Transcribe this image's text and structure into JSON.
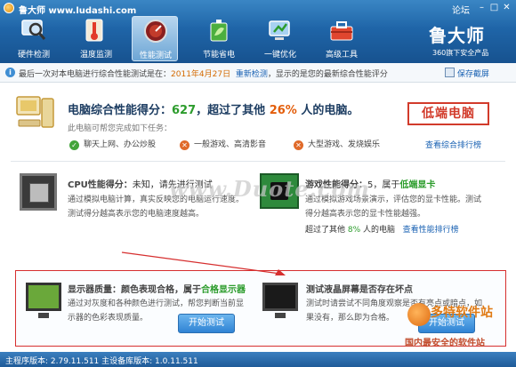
{
  "window": {
    "title": "鲁大师 www.ludashi.com",
    "forum_link": "论坛",
    "min": "–",
    "max": "□",
    "close": "✕"
  },
  "nav": {
    "tabs": [
      {
        "label": "硬件检测",
        "icon": "magnifier-monitor-icon"
      },
      {
        "label": "温度监测",
        "icon": "thermometer-icon"
      },
      {
        "label": "性能测试",
        "icon": "gauge-icon",
        "active": true
      },
      {
        "label": "节能省电",
        "icon": "battery-leaf-icon"
      },
      {
        "label": "一键优化",
        "icon": "optimize-icon"
      },
      {
        "label": "高级工具",
        "icon": "toolbox-icon"
      }
    ]
  },
  "brand": {
    "name": "鲁大师",
    "sub": "360旗下安全产品"
  },
  "infobar": {
    "icon": "i",
    "prefix": "最后一次对本电脑进行综合性能测试是在：",
    "date": "2011年4月27日",
    "retest": "重新检测",
    "suffix": "，显示的是您的最新综合性能评分",
    "save_report": "保存截屏"
  },
  "summary": {
    "title_a": "电脑综合性能得分：",
    "score": "627",
    "title_b": "，超过了其他",
    "percent": "26%",
    "title_c": "人的电脑。",
    "stamp": "低端电脑",
    "task_prompt": "此电脑可帮您完成如下任务：",
    "tasks": [
      {
        "label": "聊天上网、办公炒股",
        "ok": true
      },
      {
        "label": "一般游戏、高清影音",
        "ok": false
      },
      {
        "label": "大型游戏、发烧娱乐",
        "ok": false
      }
    ],
    "rank_link": "查看综合排行榜"
  },
  "cpu": {
    "label": "CPU性能得分：",
    "value": "未知，请先进行测试",
    "desc1": "通过模拟电脑计算，真实反映您的电脑运行速度。",
    "desc2": "测试得分越高表示您的电脑速度越高。"
  },
  "game": {
    "label": "游戏性能得分：",
    "value": "5，属于",
    "grade": "低端显卡",
    "desc1": "通过模拟游戏场景演示，评估您的显卡性能。测试",
    "desc2": "得分越高表示您的显卡性能越强。",
    "rank_a": "超过了其他",
    "rank_pct": "8%",
    "rank_b": "人的电脑",
    "rank_link": "查看性能排行榜"
  },
  "watermark": "www.Duote.com",
  "display": {
    "label": "显示器质量：颜色表现合格，属于",
    "grade": "合格显示器",
    "desc1": "通过对灰度和各种颜色进行测试，帮您判断当前显",
    "desc2": "示器的色彩表现质量。",
    "button": "开始测试"
  },
  "lcd": {
    "label": "测试液晶屏幕是否存在坏点",
    "desc1": "测试时请尝试不同角度观察是否有亮点或暗点，如",
    "desc2": "果没有，那么即为合格。",
    "button": "开始测试"
  },
  "corner_logo": {
    "name": "多特软件站",
    "sub": "国内最安全的软件站"
  },
  "status": {
    "text": "主程序版本: 2.79.11.511    主设备库版本: 1.0.11.511"
  }
}
